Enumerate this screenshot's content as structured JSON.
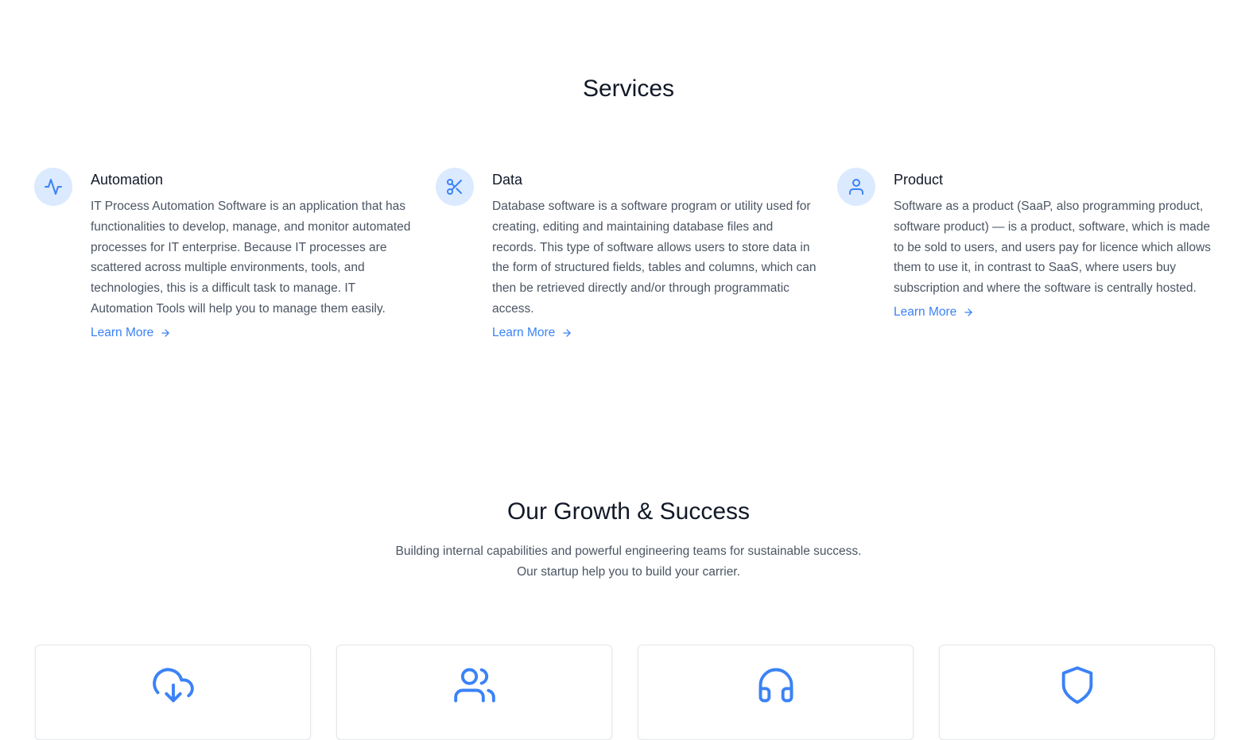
{
  "services": {
    "title": "Services",
    "items": [
      {
        "icon": "activity-icon",
        "title": "Automation",
        "description": "IT Process Automation Software is an application that has functionalities to develop, manage, and monitor automated processes for IT enterprise. Because IT processes are scattered across multiple environments, tools, and technologies, this is a difficult task to manage. IT Automation Tools will help you to manage them easily.",
        "link": "Learn More"
      },
      {
        "icon": "scissors-icon",
        "title": "Data",
        "description": "Database software is a software program or utility used for creating, editing and maintaining database files and records. This type of software allows users to store data in the form of structured fields, tables and columns, which can then be retrieved directly and/or through programmatic access.",
        "link": "Learn More"
      },
      {
        "icon": "user-icon",
        "title": "Product",
        "description": "Software as a product (SaaP, also programming product, software product) — is a product, software, which is made to be sold to users, and users pay for licence which allows them to use it, in contrast to SaaS, where users buy subscription and where the software is centrally hosted.",
        "link": "Learn More"
      }
    ]
  },
  "growth": {
    "title": "Our Growth & Success",
    "subtitle_line1": "Building internal capabilities and powerful engineering teams for sustainable success.",
    "subtitle_line2": "Our startup help you to build your carrier.",
    "cards": [
      {
        "icon": "cloud-download-icon"
      },
      {
        "icon": "users-icon"
      },
      {
        "icon": "headphones-icon"
      },
      {
        "icon": "shield-icon"
      }
    ]
  },
  "colors": {
    "accent": "#3b82f6",
    "icon_bg": "#dbeafe",
    "heading": "#111827",
    "body": "#4b5563"
  }
}
